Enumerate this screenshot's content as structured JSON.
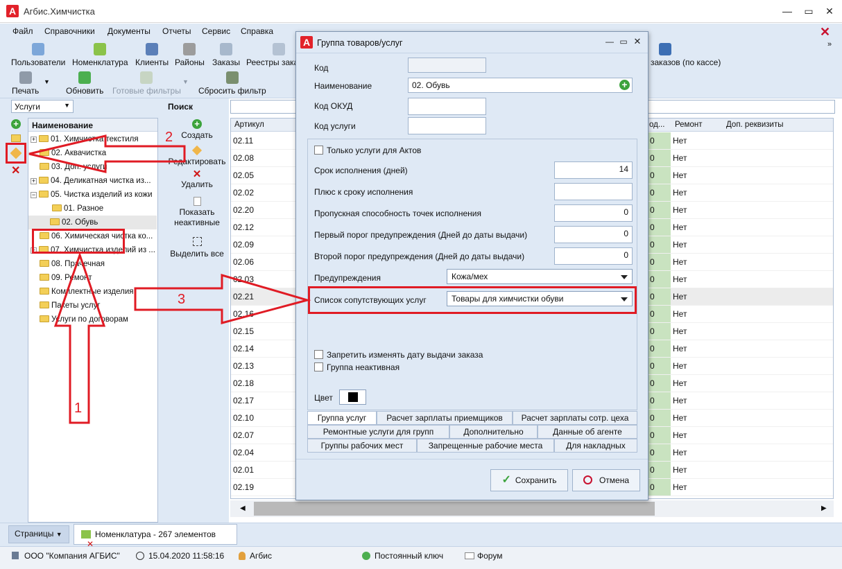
{
  "app": {
    "title": "Агбис.Химчистка"
  },
  "menu": [
    "Файл",
    "Справочники",
    "Документы",
    "Отчеты",
    "Сервис",
    "Справка"
  ],
  "ribbon": {
    "top": [
      "Пользователи",
      "Номенклатура",
      "Клиенты",
      "Районы",
      "Заказы",
      "Реестры заказ"
    ],
    "top_right": "заказов (по кассе)",
    "print": "Печать",
    "refresh": "Обновить",
    "ready_filters": "Готовые фильтры",
    "reset_filter": "Сбросить фильтр"
  },
  "left": {
    "select_value": "Услуги",
    "tree_header": "Наименование",
    "tree": [
      "01. Химчистка текстиля",
      "02. Аквачистка",
      "03. Доп. услуги",
      "04. Деликатная чистка из...",
      "05. Чистка изделий из кожи",
      "01. Разное",
      "02. Обувь",
      "06. Химическая чистка ко...",
      "07. Химчистка изделий из ...",
      "08. Прачечная",
      "09. Ремонт",
      "Комплектные изделия",
      "Пакеты услуг",
      "Услуги по договорам"
    ]
  },
  "actions": {
    "search": "Поиск",
    "create": "Создать",
    "edit": "Редактировать",
    "delete": "Удалить",
    "show_inactive": "Показать неактивные",
    "select_all": "Выделить все"
  },
  "grid": {
    "headers": {
      "article": "Артикул",
      "code": "од...",
      "repair": "Ремонт",
      "extra": "Доп. реквизиты"
    },
    "rows": [
      [
        "02.11",
        "0",
        "Нет"
      ],
      [
        "02.08",
        "0",
        "Нет"
      ],
      [
        "02.05",
        "0",
        "Нет"
      ],
      [
        "02.02",
        "0",
        "Нет"
      ],
      [
        "02.20",
        "0",
        "Нет"
      ],
      [
        "02.12",
        "0",
        "Нет"
      ],
      [
        "02.09",
        "0",
        "Нет"
      ],
      [
        "02.06",
        "0",
        "Нет"
      ],
      [
        "02.03",
        "0",
        "Нет"
      ],
      [
        "02.21",
        "0",
        "Нет"
      ],
      [
        "02.16",
        "0",
        "Нет"
      ],
      [
        "02.15",
        "0",
        "Нет"
      ],
      [
        "02.14",
        "0",
        "Нет"
      ],
      [
        "02.13",
        "0",
        "Нет"
      ],
      [
        "02.18",
        "0",
        "Нет"
      ],
      [
        "02.17",
        "0",
        "Нет"
      ],
      [
        "02.10",
        "0",
        "Нет"
      ],
      [
        "02.07",
        "0",
        "Нет"
      ],
      [
        "02.04",
        "0",
        "Нет"
      ],
      [
        "02.01",
        "0",
        "Нет"
      ],
      [
        "02.19",
        "0",
        "Нет"
      ]
    ]
  },
  "dialog": {
    "title": "Группа товаров/услуг",
    "code_label": "Код",
    "code_value": "",
    "name_label": "Наименование",
    "name_value": "02. Обувь",
    "okud_label": "Код ОКУД",
    "okud_value": "",
    "service_code_label": "Код услуги",
    "service_code_value": "",
    "only_acts_label": "Только услуги для Актов",
    "term_label": "Срок исполнения (дней)",
    "term_value": "14",
    "plus_term_label": "Плюс к сроку исполнения",
    "plus_term_value": "",
    "capacity_label": "Пропускная способность точек исполнения",
    "capacity_value": "0",
    "warn1_label": "Первый порог предупреждения (Дней до даты выдачи)",
    "warn1_value": "0",
    "warn2_label": "Второй порог предупреждения (Дней до даты выдачи)",
    "warn2_value": "0",
    "warnings_label": "Предупреждения",
    "warnings_value": "Кожа/мех",
    "related_label": "Список сопутствующих услуг",
    "related_value": "Товары для химчистки обуви",
    "forbid_date_label": "Запретить изменять дату выдачи заказа",
    "inactive_label": "Группа неактивная",
    "color_label": "Цвет",
    "color_value": "#000000",
    "tabs": [
      [
        "Группа услуг",
        "Расчет зарплаты приемщиков",
        "Расчет зарплаты сотр. цеха"
      ],
      [
        "Ремонтные услуги для групп",
        "Дополнительно",
        "Данные об агенте"
      ],
      [
        "Группы рабочих мест",
        "Запрещенные рабочие места",
        "Для накладных"
      ]
    ],
    "save": "Сохранить",
    "cancel": "Отмена"
  },
  "bottom": {
    "pages": "Страницы",
    "tab": "Номенклатура - 267 элементов",
    "company": "ООО \"Компания АГБИС\"",
    "datetime": "15.04.2020 11:58:16",
    "user": "Агбис",
    "key": "Постоянный ключ",
    "forum": "Форум"
  },
  "annotations": {
    "n1": "1",
    "n2": "2",
    "n3": "3"
  },
  "colors": {
    "accent": "#e01b24",
    "panel": "#dfe9f5",
    "highlight": "#c9e3c0"
  }
}
